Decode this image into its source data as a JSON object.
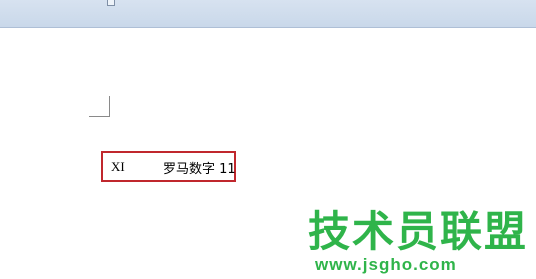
{
  "document": {
    "roman_numeral": "XI",
    "description": "罗马数字 11"
  },
  "watermark": {
    "title": "技术员联盟",
    "url": "www.jsgho.com"
  },
  "colors": {
    "highlight_border": "#c0272d",
    "watermark": "#2fb44a",
    "ribbon": "#d7e2f0"
  }
}
